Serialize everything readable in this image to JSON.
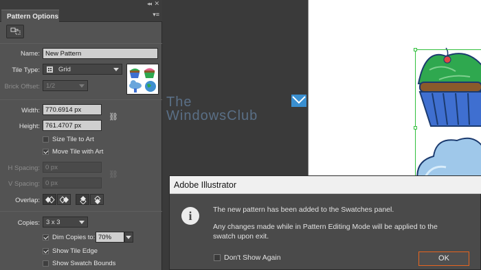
{
  "panel": {
    "title": "Pattern Options",
    "collapse_glyph": "◂◂",
    "close_glyph": "✕",
    "menu_glyph": "▾≡",
    "tile_tool_icon": "pattern-tile-tool-icon",
    "name_label": "Name:",
    "name_value": "New Pattern",
    "tile_type_label": "Tile Type:",
    "tile_type_value": "Grid",
    "brick_offset_label": "Brick Offset:",
    "brick_offset_value": "1/2",
    "width_label": "Width:",
    "width_value": "770.6914 px",
    "height_label": "Height:",
    "height_value": "761.4707 px",
    "size_tile_to_art": {
      "label": "Size Tile to Art",
      "checked": false
    },
    "move_tile_with_art": {
      "label": "Move Tile with Art",
      "checked": true
    },
    "h_spacing_label": "H Spacing:",
    "h_spacing_value": "0 px",
    "v_spacing_label": "V Spacing:",
    "v_spacing_value": "0 px",
    "overlap_label": "Overlap:",
    "copies_label": "Copies:",
    "copies_value": "3 x 3",
    "dim_copies": {
      "label": "Dim Copies to:",
      "checked": true,
      "value": "70%"
    },
    "show_tile_edge": {
      "label": "Show Tile Edge",
      "checked": true
    },
    "show_swatch_bounds": {
      "label": "Show Swatch Bounds",
      "checked": false
    }
  },
  "watermark": {
    "line1": "The",
    "line2": "WindowsClub"
  },
  "dialog": {
    "title": "Adobe Illustrator",
    "message1": "The new pattern has been added to the Swatches panel.",
    "message2a": "Any changes made while in Pattern Editing Mode will be applied to the",
    "message2b": "swatch upon exit.",
    "dont_show_again": "Don't Show Again",
    "ok": "OK"
  },
  "colors": {
    "panel_bg": "#535353",
    "workspace_bg": "#3a3a3a",
    "selection": "#2fbf3a",
    "ok_border": "#e8651f",
    "cupcake_frosting": "#2fa84f",
    "cupcake_wrapper": "#3f6fd0",
    "cupcake_cake": "#8a5a2b",
    "cloud": "#9fc8ea"
  }
}
